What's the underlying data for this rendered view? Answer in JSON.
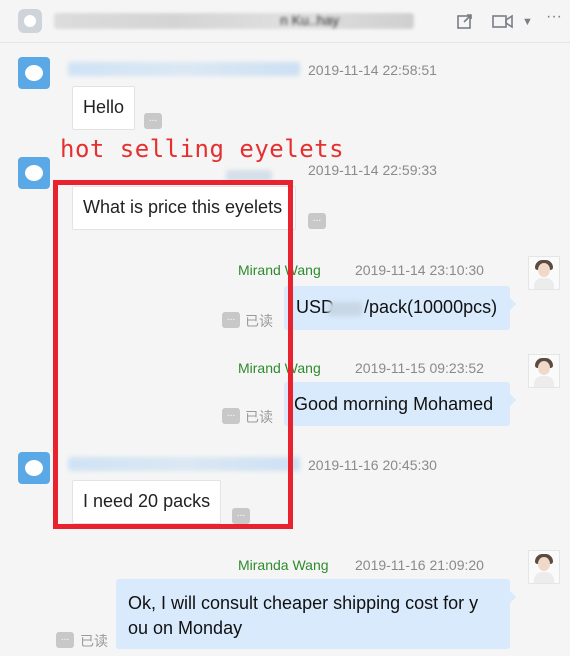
{
  "header": {
    "title_fragment": "n Ku..hay",
    "icons": [
      "share-icon",
      "video-icon",
      "chevron-down-icon",
      "more-icon"
    ]
  },
  "messages": [
    {
      "side": "in",
      "timestamp": "2019-11-14 22:58:51",
      "text": "Hello",
      "more": "..."
    },
    {
      "side": "in",
      "timestamp": "2019-11-14 22:59:33",
      "text": "What is price this eyelets",
      "more": "..."
    },
    {
      "side": "out",
      "sender": "Mirand   Wang",
      "timestamp": "2019-11-14 23:10:30",
      "text": "USD      /pack(10000pcs)",
      "read": "已读",
      "more": "..."
    },
    {
      "side": "out",
      "sender": "Mirand   Wang",
      "timestamp": "2019-11-15 09:23:52",
      "text": "Good morning Mohamed",
      "read": "已读",
      "more": "..."
    },
    {
      "side": "in",
      "timestamp": "2019-11-16 20:45:30",
      "text": "I need 20 packs",
      "more": "..."
    },
    {
      "side": "out",
      "sender": "Miranda Wang",
      "timestamp": "2019-11-16 21:09:20",
      "text_line1": "Ok, I will consult cheaper shipping cost for y",
      "text_line2": "ou on Monday",
      "read": "已读",
      "more": "..."
    }
  ],
  "annotation": {
    "label": "hot selling eyelets",
    "color": "#e8232f"
  },
  "colors": {
    "outgoing_bubble": "#d8eafc",
    "incoming_bubble": "#ffffff",
    "sender_name": "#2e8b2e",
    "avatar": "#5aa9e6"
  }
}
